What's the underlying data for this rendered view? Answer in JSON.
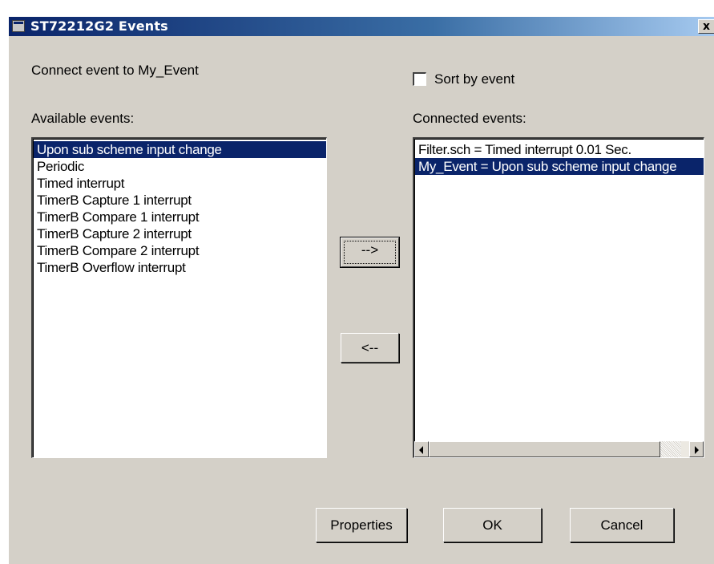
{
  "window": {
    "title": "ST72212G2 Events",
    "close_glyph": "x"
  },
  "dialog": {
    "connect_label": "Connect event to My_Event",
    "sort_label": "Sort by event",
    "sort_checked": false,
    "available_label": "Available events:",
    "connected_label": "Connected events:",
    "available_events": [
      "Upon sub scheme input change",
      "Periodic",
      "Timed interrupt",
      "TimerB Capture 1 interrupt",
      "TimerB Compare 1 interrupt",
      "TimerB Capture 2 interrupt",
      "TimerB Compare 2 interrupt",
      "TimerB Overflow interrupt"
    ],
    "available_selected_index": 0,
    "connected_events": [
      "Filter.sch = Timed interrupt 0.01 Sec.",
      "My_Event = Upon sub scheme input change"
    ],
    "connected_selected_index": 1,
    "add_button": "-->",
    "remove_button": "<--",
    "properties_button": "Properties",
    "ok_button": "OK",
    "cancel_button": "Cancel"
  },
  "colors": {
    "dialog_bg": "#d4d0c8",
    "selection": "#0a246a",
    "title_start": "#0a246a",
    "title_end": "#a6caf0"
  },
  "icons": {
    "title": "app-window-icon",
    "close": "close-icon",
    "scroll_left": "scroll-left-arrow-icon",
    "scroll_right": "scroll-right-arrow-icon"
  }
}
